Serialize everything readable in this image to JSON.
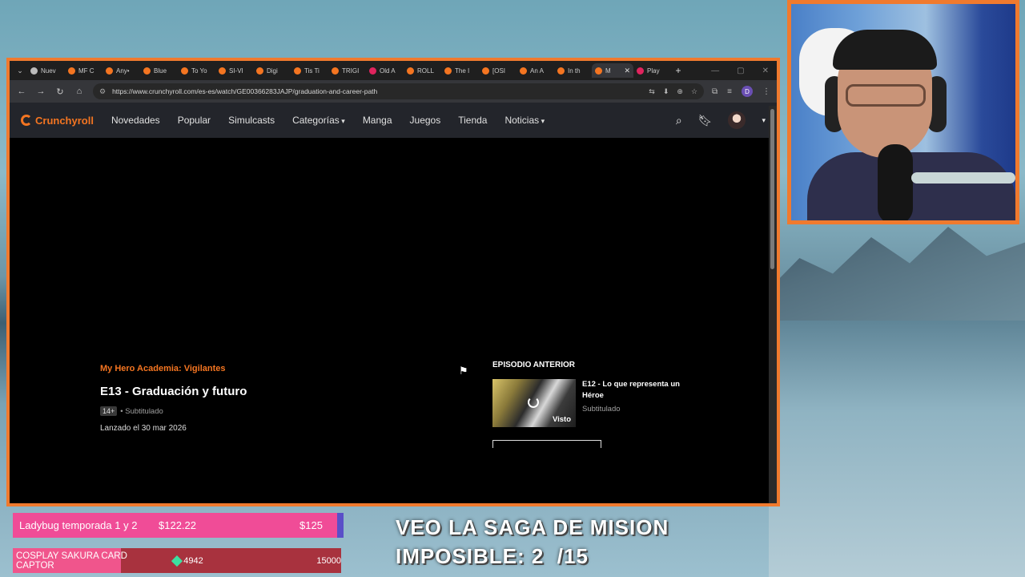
{
  "browser": {
    "tabs": [
      {
        "label": "Nuev",
        "color": "#bbbbbb"
      },
      {
        "label": "MF C",
        "color": "#f47521"
      },
      {
        "label": "Any•",
        "color": "#f47521"
      },
      {
        "label": "Blue",
        "color": "#f47521"
      },
      {
        "label": "To Yo",
        "color": "#f47521"
      },
      {
        "label": "SI-VI",
        "color": "#f47521"
      },
      {
        "label": "Digi",
        "color": "#f47521"
      },
      {
        "label": "Tis Ti",
        "color": "#f47521"
      },
      {
        "label": "TRIGI",
        "color": "#f47521"
      },
      {
        "label": "Old A",
        "color": "#e0245e"
      },
      {
        "label": "ROLL",
        "color": "#f47521"
      },
      {
        "label": "The I",
        "color": "#f47521"
      },
      {
        "label": "[OSI",
        "color": "#f47521"
      },
      {
        "label": "An A",
        "color": "#f47521"
      },
      {
        "label": "In th",
        "color": "#f47521"
      },
      {
        "label": "M",
        "color": "#f47521",
        "active": true
      },
      {
        "label": "Play",
        "color": "#e0245e"
      }
    ],
    "url": "https://www.crunchyroll.com/es-es/watch/GE00366283JAJP/graduation-and-career-path",
    "profile_initial": "D"
  },
  "crunchyroll": {
    "logo": "Crunchyroll",
    "nav": {
      "novedades": "Novedades",
      "popular": "Popular",
      "simulcasts": "Simulcasts",
      "categorias": "Categorías",
      "manga": "Manga",
      "juegos": "Juegos",
      "tienda": "Tienda",
      "noticias": "Noticias"
    },
    "episode": {
      "series": "My Hero Academia: Vigilantes",
      "title": "E13 - Graduación y futuro",
      "rating": "14+",
      "audio": "• Subtitulado",
      "release": "Lanzado el 30 mar 2026"
    },
    "previous": {
      "heading": "EPISODIO ANTERIOR",
      "title": "E12 - Lo que representa un Héroe",
      "audio": "Subtitulado",
      "watched": "Visto"
    }
  },
  "stream_overlay": {
    "goal1": {
      "label": "Ladybug temporada 1 y 2",
      "current": "$122.22",
      "target": "$125",
      "progress": 0.978
    },
    "goal2": {
      "label": "COSPLAY SAKURA CARD CAPTOR",
      "current": "4942",
      "target": "15000",
      "progress": 0.329
    },
    "message_line1": "VEO LA SAGA DE MISION",
    "message_line2": "IMPOSIBLE: 2  /15"
  }
}
